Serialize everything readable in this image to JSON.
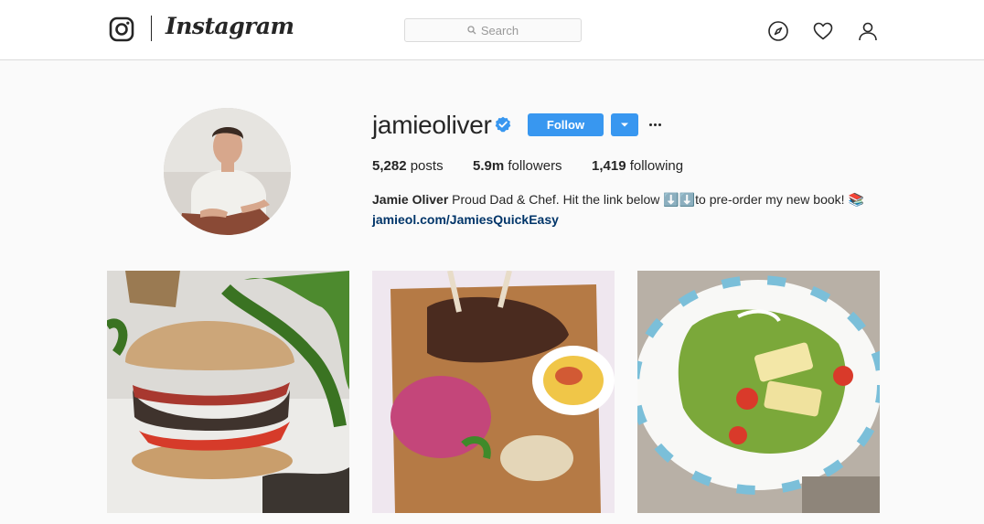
{
  "nav": {
    "brand": "Instagram",
    "search_placeholder": "Search"
  },
  "profile": {
    "username": "jamieoliver",
    "follow_label": "Follow",
    "stats": {
      "posts": "5,282",
      "posts_label": "posts",
      "followers": "5.9m",
      "followers_label": "followers",
      "following": "1,419",
      "following_label": "following"
    },
    "bio_name": "Jamie Oliver",
    "bio_text": " Proud Dad & Chef. Hit the link below ⬇️⬇️to pre-order my new book! 📚",
    "bio_link": "jamieol.com/JamiesQuickEasy"
  },
  "colors": {
    "accent": "#3897f0",
    "link": "#003569",
    "verified": "#3897f0"
  },
  "icons": [
    "instagram-logo-icon",
    "search-icon",
    "compass-icon",
    "heart-icon",
    "user-icon",
    "verified-badge-icon",
    "chevron-down-icon",
    "more-options-icon"
  ],
  "posts": [
    {
      "subject": "burger"
    },
    {
      "subject": "lamb-chops-board"
    },
    {
      "subject": "halloumi-salad"
    }
  ]
}
